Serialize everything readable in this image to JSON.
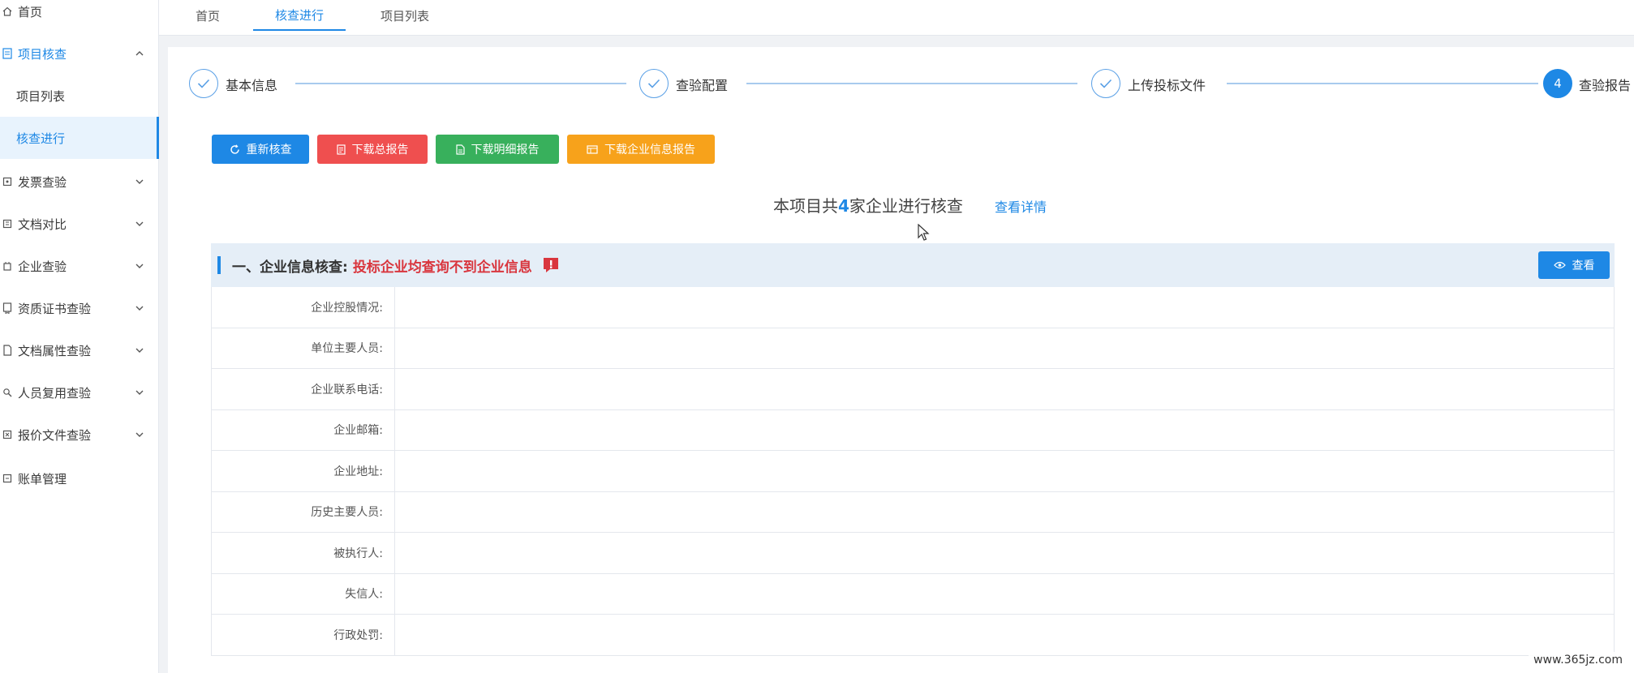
{
  "sidebar": {
    "items": [
      {
        "label": "首页",
        "icon": "home-icon",
        "top": 0
      },
      {
        "label": "项目核查",
        "icon": "project-check-icon",
        "expanded": true
      },
      {
        "label": "发票查验",
        "icon": "invoice-icon"
      },
      {
        "label": "文档对比",
        "icon": "doc-compare-icon"
      },
      {
        "label": "企业查验",
        "icon": "enterprise-icon"
      },
      {
        "label": "资质证书查验",
        "icon": "certificate-icon"
      },
      {
        "label": "文档属性查验",
        "icon": "doc-attr-icon"
      },
      {
        "label": "人员复用查验",
        "icon": "person-icon"
      },
      {
        "label": "报价文件查验",
        "icon": "quote-icon"
      },
      {
        "label": "账单管理",
        "icon": "bill-icon"
      }
    ],
    "subitems": [
      {
        "label": "项目列表"
      },
      {
        "label": "核查进行",
        "active": true
      }
    ]
  },
  "tabs": [
    {
      "label": "首页"
    },
    {
      "label": "核查进行",
      "active": true
    },
    {
      "label": "项目列表"
    }
  ],
  "steps": [
    {
      "label": "基本信息",
      "state": "done"
    },
    {
      "label": "查验配置",
      "state": "done"
    },
    {
      "label": "上传投标文件",
      "state": "done"
    },
    {
      "label": "查验报告",
      "state": "current",
      "number": "4"
    }
  ],
  "buttons": {
    "recheck": "重新核查",
    "download_total": "下载总报告",
    "download_detail": "下载明细报告",
    "download_enterprise": "下载企业信息报告"
  },
  "colors": {
    "primary": "#1e88e5",
    "danger": "#ef4f4f",
    "success": "#38b05c",
    "warning": "#f7a21b"
  },
  "summary": {
    "prefix": "本项目共",
    "count": "4",
    "suffix": "家企业进行核查",
    "link": "查看详情"
  },
  "section": {
    "title": "一、企业信息核查:",
    "warning": "投标企业均查询不到企业信息",
    "view_button": "查看"
  },
  "table_rows": [
    {
      "label": "企业控股情况:",
      "value": ""
    },
    {
      "label": "单位主要人员:",
      "value": ""
    },
    {
      "label": "企业联系电话:",
      "value": ""
    },
    {
      "label": "企业邮箱:",
      "value": ""
    },
    {
      "label": "企业地址:",
      "value": ""
    },
    {
      "label": "历史主要人员:",
      "value": ""
    },
    {
      "label": "被执行人:",
      "value": ""
    },
    {
      "label": "失信人:",
      "value": ""
    },
    {
      "label": "行政处罚:",
      "value": ""
    }
  ],
  "watermark": "www.365jz.com"
}
